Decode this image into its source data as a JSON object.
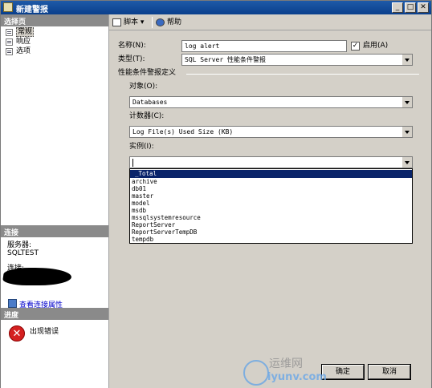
{
  "window": {
    "title": "新建警报",
    "controls": [
      "_",
      "□",
      "✕"
    ]
  },
  "left": {
    "select_page_header": "选择页",
    "nav": [
      {
        "label": "常规",
        "selected": true
      },
      {
        "label": "响应",
        "selected": false
      },
      {
        "label": "选项",
        "selected": false
      }
    ],
    "connection_header": "连接",
    "server_label": "服务器:",
    "server_value": "SQLTEST",
    "connection_label": "连接:",
    "view_conn_props": "查看连接属性",
    "progress_header": "进度",
    "progress_status": "出现错误"
  },
  "toolbar": {
    "script_label": "脚本 ▾",
    "help_label": "帮助"
  },
  "form": {
    "name_label": "名称(N):",
    "name_value": "log alert",
    "enabled_label": "启用(A)",
    "enabled_checked": "✓",
    "type_label": "类型(T):",
    "type_value": "SQL Server 性能条件警报",
    "group_title": "性能条件警报定义",
    "object_label": "对象(O):",
    "object_value": "Databases",
    "counter_label": "计数器(C):",
    "counter_value": "Log File(s) Used Size (KB)",
    "instance_label": "实例(I):",
    "instance_value": "",
    "instance_options": [
      "_Total",
      "archive",
      "db01",
      "master",
      "model",
      "msdb",
      "mssqlsystemresource",
      "ReportServer",
      "ReportServerTempDB",
      "tempdb"
    ]
  },
  "buttons": {
    "ok": "确定",
    "cancel": "取消"
  },
  "watermark": {
    "line1": "运维网",
    "line2": "iyunv.com"
  },
  "colors": {
    "titlebar": "#0a3f8c",
    "highlight": "#0a246a",
    "section_header": "#8a8a8a",
    "error": "#d42020",
    "link": "#0000cc"
  }
}
